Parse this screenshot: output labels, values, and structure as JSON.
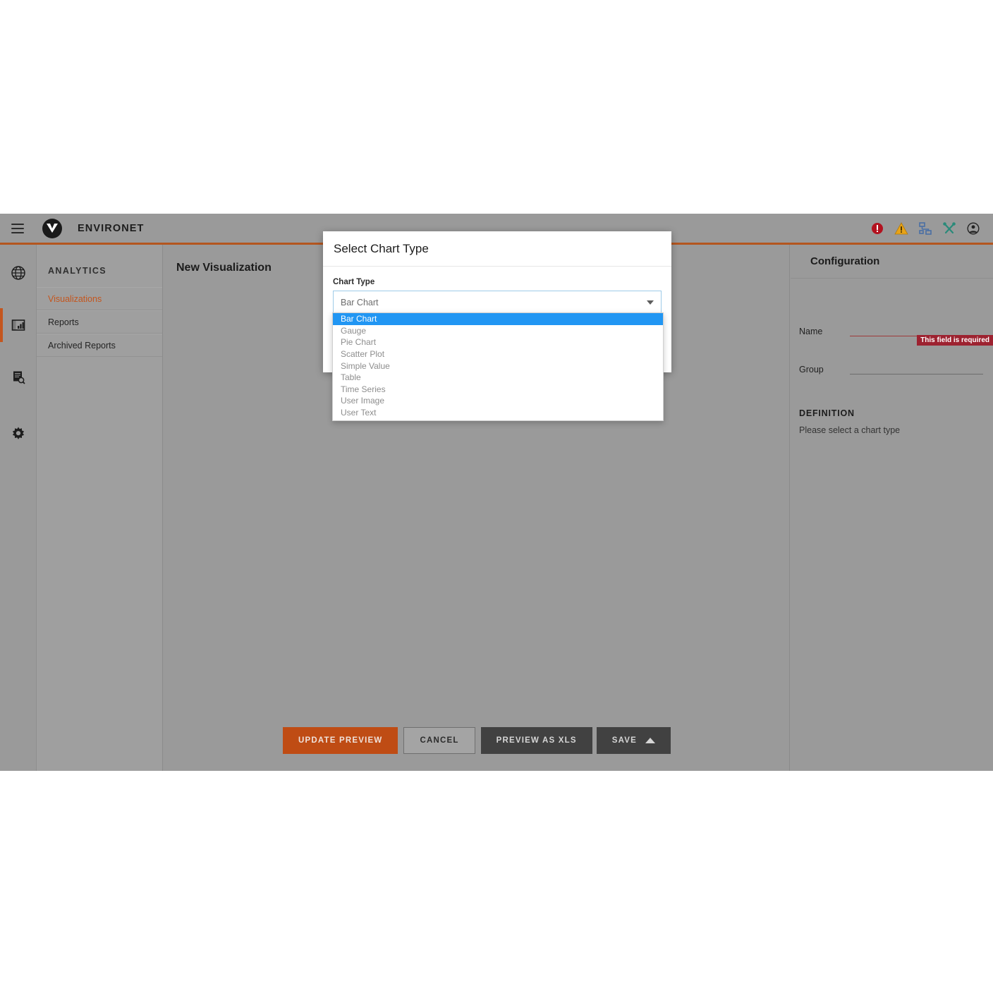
{
  "topbar": {
    "menu_icon": "hamburger-icon",
    "brand": "ENVIRONET",
    "icons": [
      {
        "name": "alarm-critical-icon",
        "glyph": "error-circle"
      },
      {
        "name": "alarm-warning-icon",
        "glyph": "warning-triangle"
      },
      {
        "name": "sitemap-icon",
        "glyph": "network"
      },
      {
        "name": "tools-icon",
        "glyph": "crossed-tools"
      },
      {
        "name": "user-account-icon",
        "glyph": "person-circle"
      }
    ]
  },
  "rail": {
    "items": [
      {
        "name": "rail-item-global",
        "icon": "globe-icon",
        "active": false
      },
      {
        "name": "rail-item-analytics",
        "icon": "bar-chart-report-icon",
        "active": true
      },
      {
        "name": "rail-item-documents",
        "icon": "document-search-icon",
        "active": false
      },
      {
        "name": "rail-item-settings",
        "icon": "gear-icon",
        "active": false
      }
    ]
  },
  "sidebar": {
    "title": "ANALYTICS",
    "items": [
      {
        "label": "Visualizations",
        "active": true
      },
      {
        "label": "Reports",
        "active": false
      },
      {
        "label": "Archived Reports",
        "active": false
      }
    ]
  },
  "main": {
    "title": "New Visualization",
    "buttons": {
      "update_preview": "UPDATE PREVIEW",
      "cancel": "CANCEL",
      "preview_xls": "PREVIEW AS XLS",
      "save": "SAVE"
    }
  },
  "config": {
    "header": "Configuration",
    "name_label": "Name",
    "name_value": "",
    "name_error": "This field is required",
    "group_label": "Group",
    "group_value": "",
    "definition_title": "DEFINITION",
    "definition_text": "Please select a chart type"
  },
  "modal": {
    "title": "Select Chart Type",
    "chart_type_label": "Chart Type",
    "chart_type_value": "Bar Chart",
    "options": [
      {
        "label": "Bar Chart",
        "selected": true
      },
      {
        "label": "Gauge",
        "selected": false
      },
      {
        "label": "Pie Chart",
        "selected": false
      },
      {
        "label": "Scatter Plot",
        "selected": false
      },
      {
        "label": "Simple Value",
        "selected": false
      },
      {
        "label": "Table",
        "selected": false
      },
      {
        "label": "Time Series",
        "selected": false
      },
      {
        "label": "User Image",
        "selected": false
      },
      {
        "label": "User Text",
        "selected": false
      }
    ]
  },
  "colors": {
    "accent_orange": "#c4561e",
    "primary_button": "#bf4c14",
    "panel_gray": "#9a9a9a",
    "highlight_blue": "#2196f3",
    "error_red": "#9d2230"
  }
}
